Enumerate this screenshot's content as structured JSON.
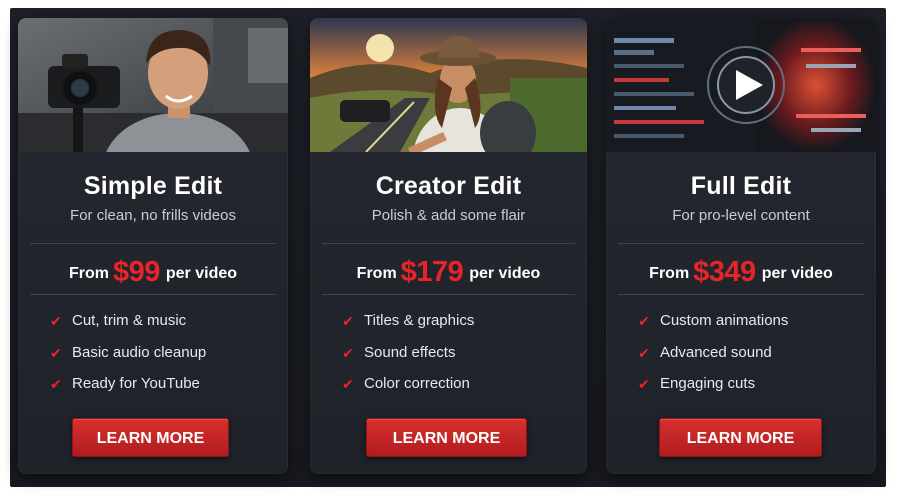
{
  "plans": [
    {
      "title": "Simple Edit",
      "subtitle": "For clean, no frills videos",
      "price_prefix": "From",
      "price": "$99",
      "price_suffix": "per video",
      "features": [
        "Cut, trim & music",
        "Basic audio cleanup",
        "Ready for YouTube"
      ],
      "button": "LEARN MORE",
      "image": "man-with-camera-photo"
    },
    {
      "title": "Creator Edit",
      "subtitle": "Polish & add some flair",
      "price_prefix": "From",
      "price": "$179",
      "price_suffix": "per video",
      "features": [
        "Titles & graphics",
        "Sound effects",
        "Color correction"
      ],
      "button": "LEARN MORE",
      "image": "woman-travel-road-photo"
    },
    {
      "title": "Full Edit",
      "subtitle": "For pro-level content",
      "price_prefix": "From",
      "price": "$349",
      "price_suffix": "per video",
      "features": [
        "Custom animations",
        "Advanced sound",
        "Engaging cuts"
      ],
      "button": "LEARN MORE",
      "image": "video-editing-timeline-play-photo"
    }
  ],
  "colors": {
    "accent": "#e8242b",
    "button": "#c4252a",
    "card": "#23262d",
    "background": "#1b1d23"
  },
  "icons": {
    "check": "✔"
  }
}
